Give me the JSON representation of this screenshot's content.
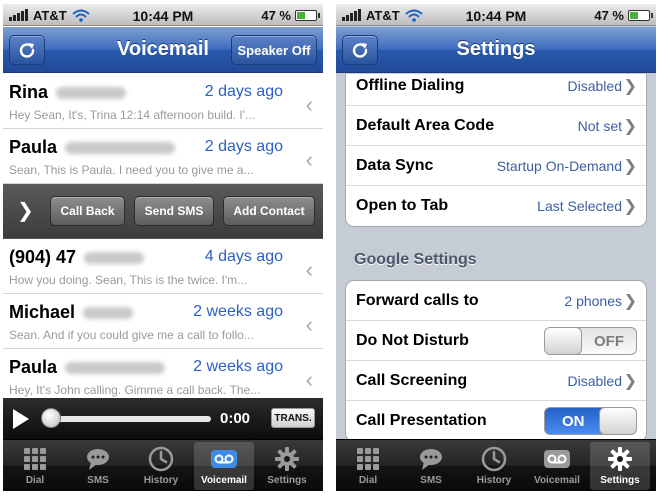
{
  "status": {
    "carrier": "AT&T",
    "time": "10:44 PM",
    "battery": "47 %",
    "battery_level": 0.47
  },
  "left": {
    "title": "Voicemail",
    "speaker_button": "Speaker Off",
    "voicemails": [
      {
        "name": "Rina",
        "date": "2 days ago",
        "preview": "Hey Sean, It's, Trina 12:14 afternoon build. I'..."
      },
      {
        "name": "Paula",
        "date": "2 days ago",
        "preview": "Sean, This is Paula. I need you to give me a..."
      },
      {
        "name": "(904) 47",
        "date": "4 days ago",
        "preview": "How you doing. Sean, This is the twice. I'm..."
      },
      {
        "name": "Michael",
        "date": "2 weeks ago",
        "preview": "Sean. And if you could give me a call to follo..."
      },
      {
        "name": "Paula",
        "date": "2 weeks ago",
        "preview": "Hey, It's John calling. Gimme a call back. The..."
      }
    ],
    "actions": {
      "call_back": "Call Back",
      "send_sms": "Send SMS",
      "add_contact": "Add Contact"
    },
    "player": {
      "time": "0:00",
      "trans": "TRANS.",
      "progress": 0
    }
  },
  "right": {
    "title": "Settings",
    "rows": [
      {
        "label": "Offline Dialing",
        "value": "Disabled"
      },
      {
        "label": "Default Area Code",
        "value": "Not set"
      },
      {
        "label": "Data Sync",
        "value": "Startup On-Demand"
      },
      {
        "label": "Open to Tab",
        "value": "Last Selected"
      }
    ],
    "google_header": "Google Settings",
    "google_rows": [
      {
        "label": "Forward calls to",
        "value": "2 phones"
      },
      {
        "label": "Do Not Disturb",
        "toggle": "OFF"
      },
      {
        "label": "Call Screening",
        "value": "Disabled"
      },
      {
        "label": "Call Presentation",
        "toggle": "ON"
      }
    ]
  },
  "tabs": [
    {
      "label": "Dial",
      "icon": "keypad-icon"
    },
    {
      "label": "SMS",
      "icon": "chat-bubble-icon"
    },
    {
      "label": "History",
      "icon": "clock-icon"
    },
    {
      "label": "Voicemail",
      "icon": "voicemail-icon"
    },
    {
      "label": "Settings",
      "icon": "gear-icon"
    }
  ],
  "colors": {
    "nav_blue": "#2a59ad",
    "link_blue": "#2a5fc7",
    "settings_bg": "#c5ccd4",
    "toggle_on": "#2563c8"
  }
}
